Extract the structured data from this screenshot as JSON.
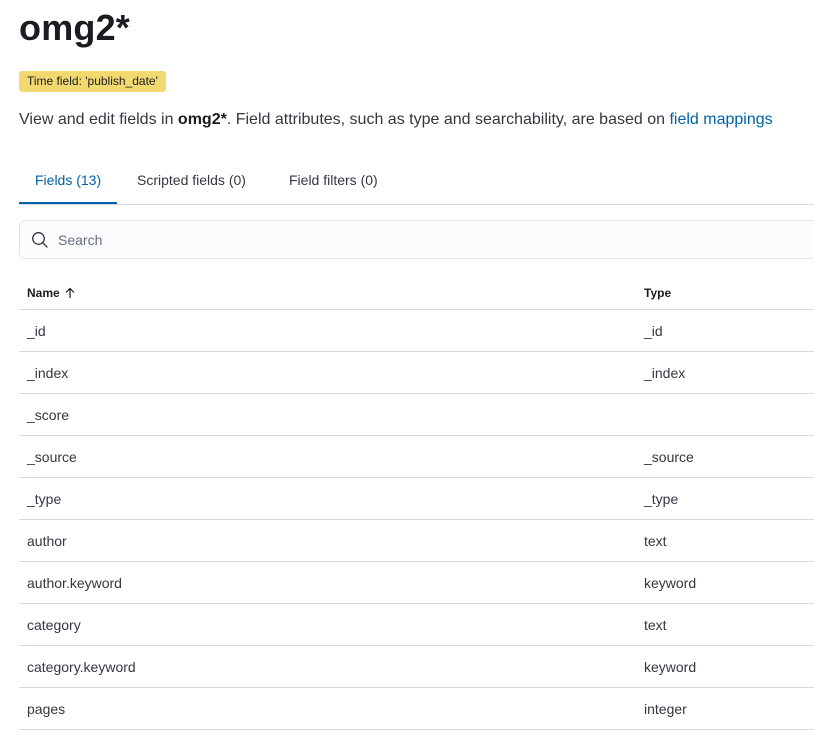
{
  "page": {
    "title": "omg2*",
    "time_field_badge": "Time field: 'publish_date'",
    "description": {
      "prefix": "View and edit fields in ",
      "pattern": "omg2*",
      "suffix": ". Field attributes, such as type and searchability, are based on ",
      "link": "field mappings"
    }
  },
  "tabs": [
    {
      "label": "Fields (13)",
      "active": true
    },
    {
      "label": "Scripted fields (0)",
      "active": false
    },
    {
      "label": "Field filters (0)",
      "active": false
    }
  ],
  "search": {
    "placeholder": "Search",
    "icon": "search-icon"
  },
  "table": {
    "columns": {
      "name": "Name",
      "type": "Type",
      "sort_icon": "arrow-up-icon"
    },
    "rows": [
      {
        "name": "_id",
        "type": "_id"
      },
      {
        "name": "_index",
        "type": "_index"
      },
      {
        "name": "_score",
        "type": ""
      },
      {
        "name": "_source",
        "type": "_source"
      },
      {
        "name": "_type",
        "type": "_type"
      },
      {
        "name": "author",
        "type": "text"
      },
      {
        "name": "author.keyword",
        "type": "keyword"
      },
      {
        "name": "category",
        "type": "text"
      },
      {
        "name": "category.keyword",
        "type": "keyword"
      },
      {
        "name": "pages",
        "type": "integer"
      }
    ]
  },
  "colors": {
    "accent": "#0061a6",
    "badge": "#f1d86f",
    "border": "#d3dae6"
  }
}
